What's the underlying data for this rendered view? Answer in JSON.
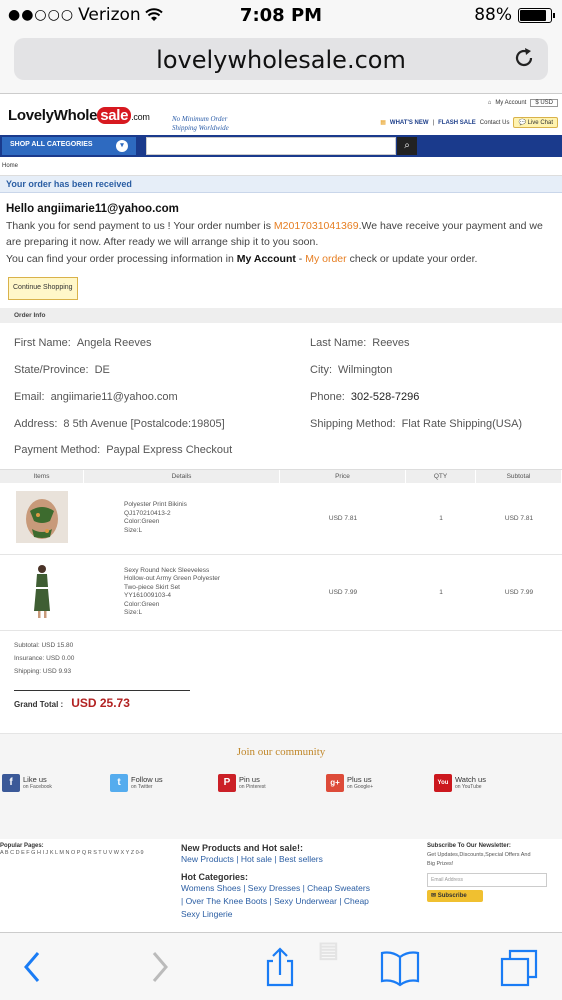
{
  "status": {
    "carrier": "Verizon",
    "time": "7:08 PM",
    "battery": "88%",
    "battery_level": 0.88
  },
  "browser": {
    "url": "lovelywholesale.com"
  },
  "site": {
    "logo_main": "LovelyWhole",
    "logo_sale": "sale",
    "logo_com": ".com",
    "tagline_1": "No Minimum Order",
    "tagline_2": "Shipping Worldwide",
    "my_account": "My Account",
    "currency": "$ USD",
    "whats_new": "WHAT'S NEW",
    "flash_sale": "FLASH SALE",
    "contact_us": "Contact Us",
    "live_chat": "Live Chat",
    "shop_all": "SHOP ALL CATEGORIES",
    "breadcrumb": "Home"
  },
  "order": {
    "banner": "Your order has been received",
    "hello": "Hello angiimarie11@yahoo.com",
    "line1_a": "Thank you for send payment to us ! Your order number is ",
    "order_number": "M2017031041369",
    "line1_b": ".We have receive your payment and we are preparing it now. After ready we will arrange ship it to you soon.",
    "line2_a": "You can find your order processing information in ",
    "my_account": "My Account",
    "dash": " - ",
    "my_order": "My order",
    "line2_b": " check or update your order.",
    "continue": "Continue Shopping",
    "info_title": "Order Info",
    "fields": {
      "first_name_label": "First Name:",
      "first_name": "Angela Reeves",
      "last_name_label": "Last Name:",
      "last_name": "Reeves",
      "state_label": "State/Province:",
      "state": "DE",
      "city_label": "City:",
      "city": "Wilmington",
      "email_label": "Email:",
      "email": "angiimarie11@yahoo.com",
      "phone_label": "Phone:",
      "phone": "302-528-7296",
      "address_label": "Address:",
      "address": "8 5th Avenue  [Postalcode:19805]",
      "shipping_label": "Shipping Method:",
      "shipping": "Flat Rate Shipping(USA)",
      "payment_label": "Payment Method:",
      "payment": "Paypal Express Checkout"
    },
    "columns": [
      "Items",
      "Details",
      "Price",
      "QTY",
      "Subtotal"
    ],
    "items": [
      {
        "name": "Polyester Print Bikinis",
        "sku": "QJ170210413-2",
        "color": "Color:Green",
        "size": "Size:L",
        "price": "USD 7.81",
        "qty": "1",
        "subtotal": "USD 7.81"
      },
      {
        "name1": "Sexy Round Neck Sleeveless",
        "name2": "Hollow-out Army Green Polyester",
        "name3": "Two-piece Skirt Set",
        "sku": "YY161009103-4",
        "color": "Color:Green",
        "size": "Size:L",
        "price": "USD 7.99",
        "qty": "1",
        "subtotal": "USD 7.99"
      }
    ],
    "subtotal": "Subtotal:  USD 15.80",
    "insurance": "Insurance:   USD 0.00",
    "shipping": "Shipping:   USD 9.93",
    "grand_label": "Grand Total :",
    "grand_total": "USD 25.73"
  },
  "community": {
    "title": "Join our community",
    "links": [
      {
        "t1": "Like us",
        "t2": "on Facebook",
        "icon": "f",
        "color": "#3b5998"
      },
      {
        "t1": "Follow us",
        "t2": "on Twitter",
        "icon": "t",
        "color": "#55acee"
      },
      {
        "t1": "Pin us",
        "t2": "on Pinterest",
        "icon": "P",
        "color": "#cb2027"
      },
      {
        "t1": "Plus us",
        "t2": "on Google+",
        "icon": "g+",
        "color": "#dd4b39"
      },
      {
        "t1": "Watch us",
        "t2": "on YouTube",
        "icon": "You",
        "color": "#cc181e"
      }
    ]
  },
  "footer": {
    "popular_title": "Popular Pages:",
    "alphabet": "A B C D E F G H I J K L M N O P Q R S T U V W X Y Z 0-9",
    "new_title": "New Products and Hot sale!:",
    "new_links": "New Products | Hot sale | Best sellers",
    "hot_title": "Hot Categories:",
    "hot_links_1": "Womens Shoes | Sexy Dresses | Cheap Sweaters",
    "hot_links_2": "| Over The Knee Boots | Sexy Underwear | Cheap",
    "hot_links_3": "Sexy Lingerie",
    "news_title": "Subscribe To Our Newsletter:",
    "news_text_1": "Get Updates,Discounts,Special Offers And",
    "news_text_2": "Big Prizes!",
    "email_placeholder": "Email Address",
    "subscribe": "Subscribe"
  }
}
